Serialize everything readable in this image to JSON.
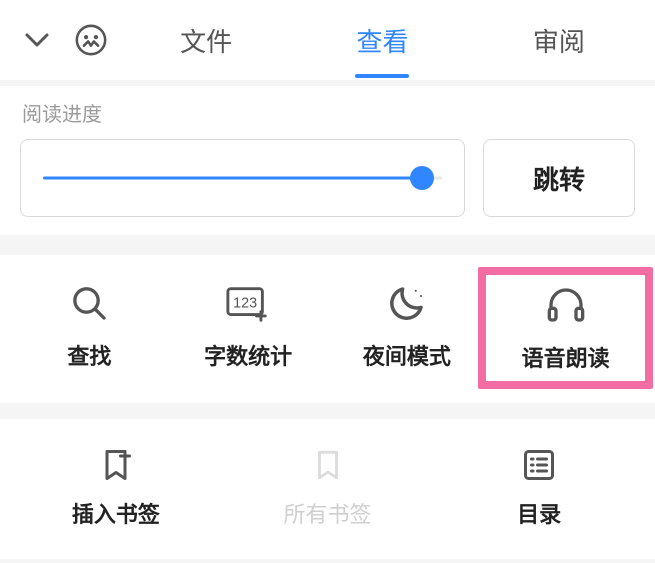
{
  "tabs": {
    "file": "文件",
    "view": "查看",
    "review": "审阅",
    "active": "view"
  },
  "progress": {
    "label": "阅读进度",
    "percent": 95,
    "jump": "跳转"
  },
  "tools": {
    "search": "查找",
    "wordcount": "字数统计",
    "night": "夜间模式",
    "tts": "语音朗读"
  },
  "bookmarks": {
    "insert": "插入书签",
    "all": "所有书签",
    "toc": "目录"
  }
}
